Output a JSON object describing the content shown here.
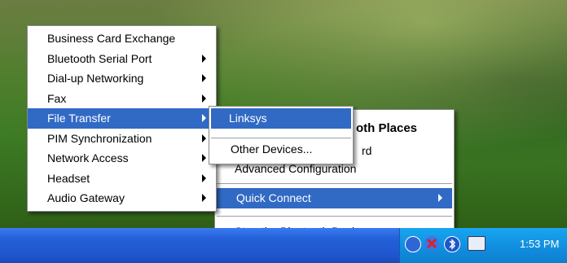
{
  "left_menu": {
    "items": [
      {
        "label": "Business Card Exchange",
        "has_submenu": false
      },
      {
        "label": "Bluetooth Serial Port",
        "has_submenu": true
      },
      {
        "label": "Dial-up Networking",
        "has_submenu": true
      },
      {
        "label": "Fax",
        "has_submenu": true
      },
      {
        "label": "File Transfer",
        "has_submenu": true,
        "selected": true
      },
      {
        "label": "PIM Synchronization",
        "has_submenu": true
      },
      {
        "label": "Network Access",
        "has_submenu": true
      },
      {
        "label": "Headset",
        "has_submenu": true
      },
      {
        "label": "Audio Gateway",
        "has_submenu": true
      }
    ]
  },
  "file_transfer_submenu": {
    "items": [
      "Linksys",
      "Other Devices..."
    ]
  },
  "bluetooth_menu": {
    "explore_label": "oth Places",
    "wizard_label": "rd",
    "advanced_label": "Advanced Configuration",
    "quick_connect_label": "Quick Connect",
    "stop_label": "Stop the Bluetooth Device"
  },
  "taskbar": {
    "clock": "1:53 PM"
  },
  "colors": {
    "selection": "#316ac5",
    "taskbar": "#2460d8",
    "tray": "#1290e0"
  }
}
